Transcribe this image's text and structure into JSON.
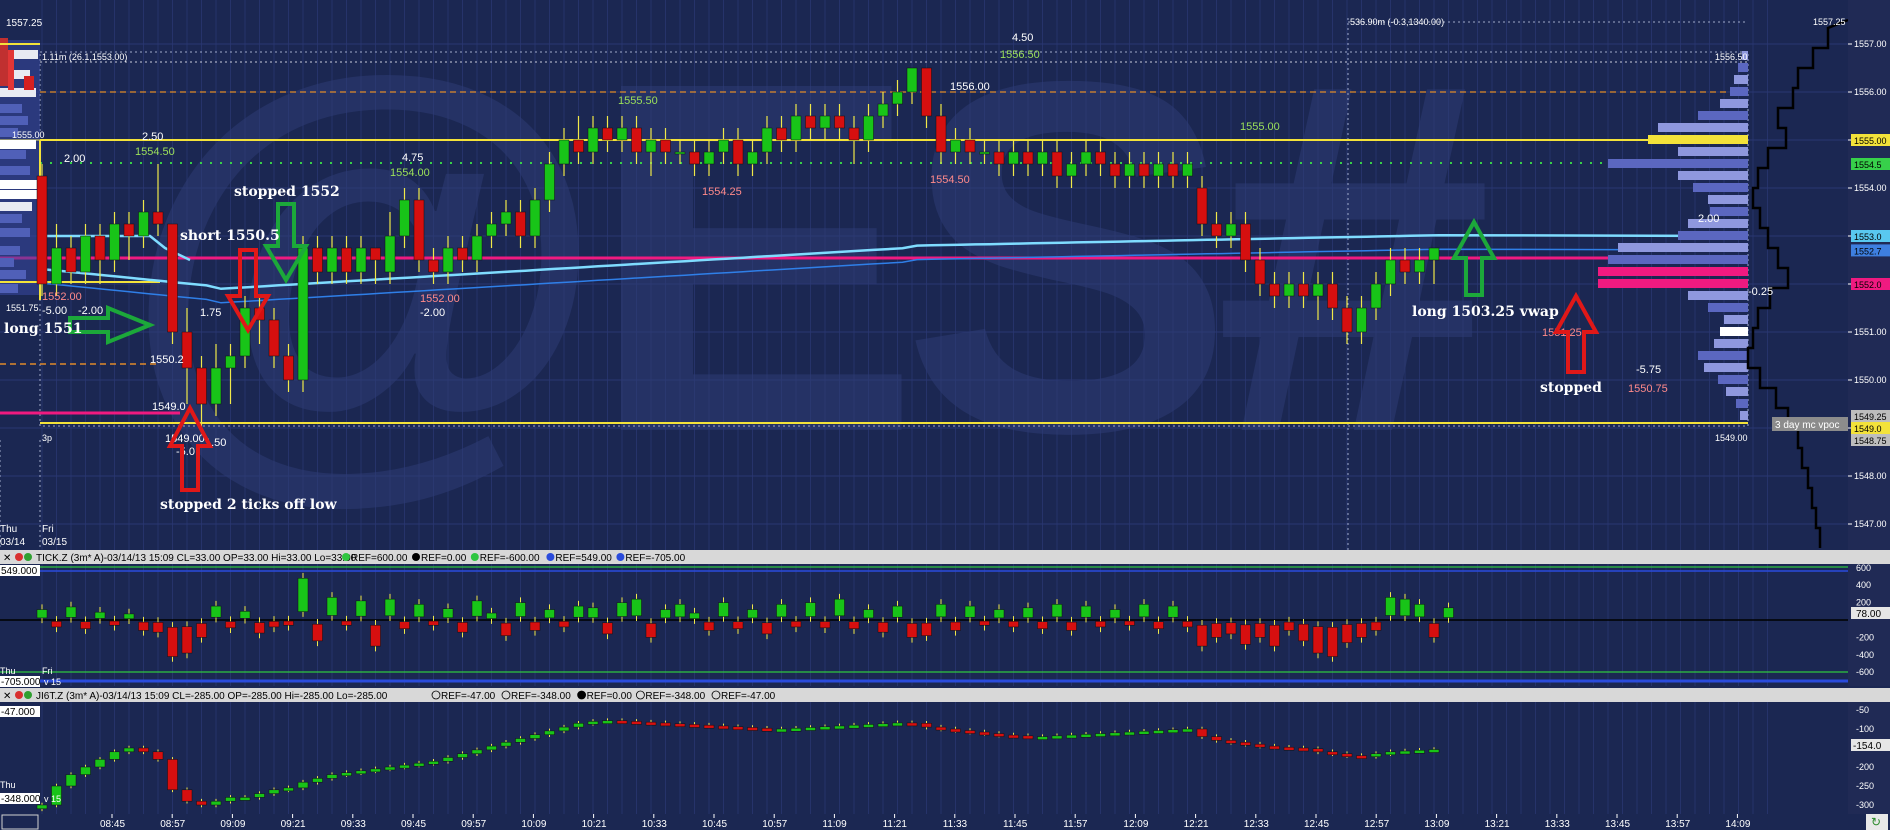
{
  "watermark": "@ES#",
  "main_panel": {
    "top_price_left": "1557.25",
    "top_price_right": "1557.25",
    "top_left_info": "1.11m (26.1,1553.00)",
    "top_center_info": "536.90m (-0.3,1340.00)",
    "right_price_ticks": [
      "1557.00",
      "1556.00",
      "1555.00",
      "1554.00",
      "1553.00",
      "1552.00",
      "1551.00",
      "1550.00",
      "1549.00",
      "1548.00",
      "1547.00"
    ],
    "right_price_markers": [
      {
        "price": "1555.00",
        "color": "#f3e23a"
      },
      {
        "price": "1554.5",
        "color": "#37d04a"
      },
      {
        "price": "1553.0",
        "color": "#59c8f0"
      },
      {
        "price": "1552.7",
        "color": "#3e7fe0"
      },
      {
        "price": "1552.0",
        "color": "#f01a80"
      },
      {
        "price": "1549.0",
        "color": "#f3e23a"
      },
      {
        "price": "1549.25",
        "color": "#bdbdbd"
      },
      {
        "price": "1548.75",
        "color": "#bdbdbd"
      }
    ],
    "left_labels": {
      "p1555": "1555.00",
      "p1551_75": "1551.75",
      "t3p": "3p"
    },
    "day_labels": [
      {
        "day": "Thu",
        "date": "03/14"
      },
      {
        "day": "Fri",
        "date": "03/15"
      }
    ],
    "profile_labels": {
      "p1556_50": "1556.50",
      "p1549_00": "1549.00",
      "p2_00": "2.00",
      "m0_25": "-0.25"
    },
    "vpoc_label": "3 day mc vpoc",
    "annotations": [
      {
        "id": "long1551",
        "text": "long 1551"
      },
      {
        "id": "short",
        "text": "short 1550.5"
      },
      {
        "id": "stopped1552",
        "text": "stopped 1552"
      },
      {
        "id": "stopped2ticks",
        "text": "stopped 2 ticks off low"
      },
      {
        "id": "long1503",
        "text": "long 1503.25 vwap"
      },
      {
        "id": "stopped",
        "text": "stopped"
      }
    ],
    "swing_labels": [
      {
        "text": "2.50",
        "c": "w"
      },
      {
        "text": "1554.50",
        "c": "g"
      },
      {
        "text": "2.00",
        "c": "w"
      },
      {
        "text": "1552.00",
        "c": "r"
      },
      {
        "text": "-5.00",
        "c": "w"
      },
      {
        "text": "-2.00",
        "c": "w"
      },
      {
        "text": "1.75",
        "c": "w"
      },
      {
        "text": "1550.2",
        "c": "w"
      },
      {
        "text": "1549.0",
        "c": "w"
      },
      {
        "text": "1549.00",
        "c": "w"
      },
      {
        "text": "-5.0",
        "c": "w"
      },
      {
        "text": "1.50",
        "c": "w"
      },
      {
        "text": "4.75",
        "c": "w"
      },
      {
        "text": "1554.00",
        "c": "g"
      },
      {
        "text": "1552.00",
        "c": "r"
      },
      {
        "text": "-2.00",
        "c": "w"
      },
      {
        "text": "1555.50",
        "c": "g"
      },
      {
        "text": "1554.25",
        "c": "r"
      },
      {
        "text": "1556.00",
        "c": "w"
      },
      {
        "text": "1554.50",
        "c": "r"
      },
      {
        "text": "4.50",
        "c": "w"
      },
      {
        "text": "1556.50",
        "c": "g"
      },
      {
        "text": "1555.00",
        "c": "g"
      },
      {
        "text": "1551.25",
        "c": "r"
      },
      {
        "text": "1550.75",
        "c": "r"
      },
      {
        "text": "-5.75",
        "c": "w"
      }
    ]
  },
  "tick_panel": {
    "header": "TICK.Z (3m* A)-03/14/13 15:09 CL=33.00 OP=33.00 Hi=33.00 Lo=33.00",
    "refs": [
      {
        "text": "REF=600.00",
        "color": "#2fc640"
      },
      {
        "text": "REF=0.00",
        "color": "#000000"
      },
      {
        "text": "REF=-600.00",
        "color": "#2fc640"
      },
      {
        "text": "REF=549.00",
        "color": "#2a4bdc"
      },
      {
        "text": "REF=-705.00",
        "color": "#2a4bdc"
      }
    ],
    "left_top": "549.000",
    "left_bottom": "-705.000",
    "left_suffix": "v 15",
    "right_ticks": [
      "600",
      "400",
      "200",
      "78.00",
      "-200",
      "-400",
      "-600"
    ],
    "current": "78.00"
  },
  "jiqt_panel": {
    "header": "JI6T.Z (3m* A)-03/14/13 15:09 CL=-285.00 OP=-285.00 Hi=-285.00 Lo=-285.00",
    "refs": [
      {
        "text": "REF=-47.00",
        "color": "#ffffff"
      },
      {
        "text": "REF=-348.00",
        "color": "#ffffff"
      },
      {
        "text": "REF=0.00",
        "color": "#000000"
      },
      {
        "text": "REF=-348.00",
        "color": "#ffffff"
      },
      {
        "text": "REF=-47.00",
        "color": "#ffffff"
      }
    ],
    "left_top": "-47.000",
    "left_bottom": "-348.000",
    "left_suffix": "v 15",
    "right_ticks": [
      "-50",
      "-100",
      "-150",
      "-200",
      "-250",
      "-300"
    ],
    "current": "-154.0"
  },
  "time_axis": [
    "08:45",
    "08:57",
    "09:09",
    "09:21",
    "09:33",
    "09:45",
    "09:57",
    "10:09",
    "10:21",
    "10:33",
    "10:45",
    "10:57",
    "11:09",
    "11:21",
    "11:33",
    "11:45",
    "11:57",
    "12:09",
    "12:21",
    "12:33",
    "12:45",
    "12:57",
    "13:09",
    "13:21",
    "13:33",
    "13:45",
    "13:57",
    "14:09"
  ],
  "chart_data": {
    "type": "candlestick",
    "title": "@ES#",
    "x_unit": "time",
    "price_range": [
      1546.5,
      1557.25
    ],
    "key_levels": {
      "vwap": "cyan line",
      "vpoc_3day": 1549.0,
      "yellow_high": 1555.0,
      "magenta": 1552.0
    },
    "price_series_close_approx": [
      1552.75,
      1552.5,
      1552,
      1552.25,
      1553,
      1552.75,
      1553.25,
      1553,
      1553.25,
      1551.75,
      1550.25,
      1549.5,
      1550,
      1550.25,
      1551,
      1551.5,
      1550.5,
      1550,
      1552.75,
      1552.25,
      1552.5,
      1552,
      1552.5,
      1552.25,
      1553,
      1553.5,
      1552.5,
      1552.25,
      1552.25,
      1552.5,
      1553,
      1553.25,
      1553.5,
      1553,
      1553.75,
      1554.5,
      1554.75,
      1554.5,
      1554.75,
      1555,
      1554.75,
      1554.5,
      1554.5,
      1554.75,
      1555,
      1554.75,
      1554.5,
      1554.5,
      1554.75,
      1554.75,
      1554.75,
      1555,
      1555.5,
      1555.25,
      1555.5,
      1555.25,
      1555.5,
      1555.75,
      1556,
      1556.5,
      1555.5,
      1554.75,
      1555,
      1554.75,
      1554.75,
      1554.75,
      1554.5,
      1554.5,
      1554.75,
      1554.75,
      1554.25,
      1554.5,
      1554.75,
      1554.5,
      1554.5,
      1554.5,
      1554.25,
      1554.25,
      1554.25,
      1554.5,
      1553.5,
      1553.25,
      1553.25,
      1552.5,
      1552.25,
      1552,
      1552,
      1552,
      1551.75,
      1552,
      1551.5,
      1551,
      1551.5,
      1552,
      1552.5,
      1552.5,
      1552.75
    ]
  }
}
